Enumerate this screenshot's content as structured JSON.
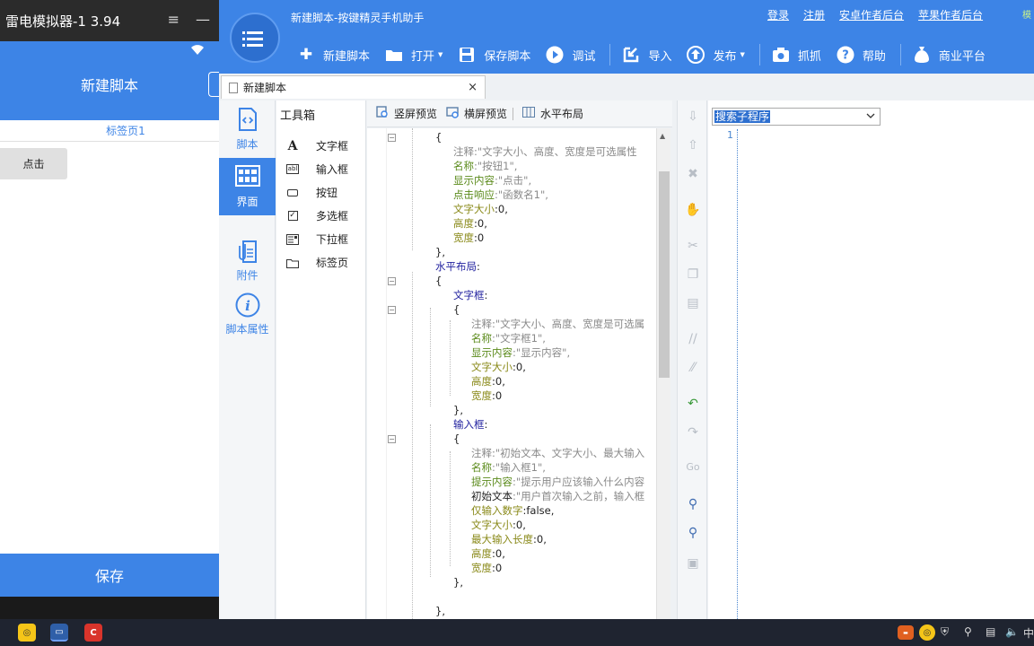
{
  "emulator": {
    "title": "雷电模拟器-1 3.94",
    "menu_icon": "≡",
    "minimize_icon": "—",
    "wifi_icon": "wifi-icon",
    "header_title": "新建脚本",
    "tab_label": "标签页1",
    "button_label": "点击",
    "save_label": "保存"
  },
  "app": {
    "title": "新建脚本-按键精灵手机助手",
    "links": [
      "登录",
      "注册",
      "安卓作者后台",
      "苹果作者后台"
    ],
    "link_more": "模",
    "toolbar": [
      {
        "label": "新建脚本",
        "icon": "plus-icon",
        "caret": false
      },
      {
        "label": "打开",
        "icon": "folder-icon",
        "caret": true
      },
      {
        "label": "保存脚本",
        "icon": "floppy-icon",
        "caret": false
      },
      {
        "label": "调试",
        "icon": "play-icon",
        "caret": false
      },
      {
        "label": "导入",
        "icon": "import-icon",
        "caret": false
      },
      {
        "label": "发布",
        "icon": "publish-icon",
        "caret": true
      },
      {
        "label": "抓抓",
        "icon": "camera-icon",
        "caret": false
      },
      {
        "label": "帮助",
        "icon": "help-icon",
        "caret": false
      },
      {
        "label": "商业平台",
        "icon": "money-bag-icon",
        "caret": false
      }
    ],
    "doc_tab": "新建脚本",
    "doc_tab_close": "×",
    "nav": [
      {
        "label": "脚本",
        "icon": "script-icon",
        "active": false
      },
      {
        "label": "界面",
        "icon": "layout-icon",
        "active": true
      },
      {
        "label": "附件",
        "icon": "attachment-icon",
        "active": false
      },
      {
        "label": "脚本属性",
        "icon": "info-icon",
        "active": false
      }
    ],
    "toolbox": {
      "title": "工具箱",
      "items": [
        {
          "label": "文字框",
          "icon": "text-icon"
        },
        {
          "label": "输入框",
          "icon": "input-icon"
        },
        {
          "label": "按钮",
          "icon": "button-icon"
        },
        {
          "label": "多选框",
          "icon": "checkbox-icon"
        },
        {
          "label": "下拉框",
          "icon": "dropdown-icon"
        },
        {
          "label": "标签页",
          "icon": "tabpage-icon"
        }
      ]
    },
    "editor_tools": [
      "竖屏预览",
      "横屏预览",
      "水平布局"
    ],
    "code_lines": [
      {
        "indent": 2,
        "parts": [
          [
            "",
            "{"
          ]
        ]
      },
      {
        "indent": 3,
        "parts": [
          [
            "c-cm",
            "注释:\"文字大小、高度、宽度是可选属性"
          ]
        ]
      },
      {
        "indent": 3,
        "parts": [
          [
            "c-gr",
            "名称"
          ],
          [
            "c-cm",
            ":\"按钮1\","
          ]
        ]
      },
      {
        "indent": 3,
        "parts": [
          [
            "c-gr",
            "显示内容"
          ],
          [
            "c-cm",
            ":\"点击\","
          ]
        ]
      },
      {
        "indent": 3,
        "parts": [
          [
            "c-gr",
            "点击响应"
          ],
          [
            "c-cm",
            ":\"函数名1\","
          ]
        ]
      },
      {
        "indent": 3,
        "parts": [
          [
            "c-ol",
            "文字大小"
          ],
          [
            "",
            ":0,"
          ]
        ]
      },
      {
        "indent": 3,
        "parts": [
          [
            "c-ol",
            "高度"
          ],
          [
            "",
            ":0,"
          ]
        ]
      },
      {
        "indent": 3,
        "parts": [
          [
            "c-ol",
            "宽度"
          ],
          [
            "",
            ":0"
          ]
        ]
      },
      {
        "indent": 2,
        "parts": [
          [
            "",
            "},"
          ]
        ]
      },
      {
        "indent": 2,
        "parts": [
          [
            "c-bl",
            "水平布局"
          ],
          [
            "",
            ":"
          ]
        ]
      },
      {
        "indent": 2,
        "parts": [
          [
            "",
            "{"
          ]
        ]
      },
      {
        "indent": 3,
        "parts": [
          [
            "c-bl",
            "文字框"
          ],
          [
            "",
            ":"
          ]
        ]
      },
      {
        "indent": 3,
        "parts": [
          [
            "",
            "{"
          ]
        ]
      },
      {
        "indent": 4,
        "parts": [
          [
            "c-cm",
            "注释:\"文字大小、高度、宽度是可选属"
          ]
        ]
      },
      {
        "indent": 4,
        "parts": [
          [
            "c-gr",
            "名称"
          ],
          [
            "c-cm",
            ":\"文字框1\","
          ]
        ]
      },
      {
        "indent": 4,
        "parts": [
          [
            "c-gr",
            "显示内容"
          ],
          [
            "c-cm",
            ":\"显示内容\","
          ]
        ]
      },
      {
        "indent": 4,
        "parts": [
          [
            "c-ol",
            "文字大小"
          ],
          [
            "",
            ":0,"
          ]
        ]
      },
      {
        "indent": 4,
        "parts": [
          [
            "c-ol",
            "高度"
          ],
          [
            "",
            ":0,"
          ]
        ]
      },
      {
        "indent": 4,
        "parts": [
          [
            "c-ol",
            "宽度"
          ],
          [
            "",
            ":0"
          ]
        ]
      },
      {
        "indent": 3,
        "parts": [
          [
            "",
            "},"
          ]
        ]
      },
      {
        "indent": 3,
        "parts": [
          [
            "c-bl",
            "输入框"
          ],
          [
            "",
            ":"
          ]
        ]
      },
      {
        "indent": 3,
        "parts": [
          [
            "",
            "{"
          ]
        ]
      },
      {
        "indent": 4,
        "parts": [
          [
            "c-cm",
            "注释:\"初始文本、文字大小、最大输入"
          ]
        ]
      },
      {
        "indent": 4,
        "parts": [
          [
            "c-gr",
            "名称"
          ],
          [
            "c-cm",
            ":\"输入框1\","
          ]
        ]
      },
      {
        "indent": 4,
        "parts": [
          [
            "c-gr",
            "提示内容"
          ],
          [
            "c-cm",
            ":\"提示用户应该输入什么内容"
          ]
        ]
      },
      {
        "indent": 4,
        "parts": [
          [
            "",
            "初始文本"
          ],
          [
            "c-cm",
            ":\"用户首次输入之前，输入框"
          ]
        ]
      },
      {
        "indent": 4,
        "parts": [
          [
            "c-ol",
            "仅输入数字"
          ],
          [
            "",
            ":false,"
          ]
        ]
      },
      {
        "indent": 4,
        "parts": [
          [
            "c-ol",
            "文字大小"
          ],
          [
            "",
            ":0,"
          ]
        ]
      },
      {
        "indent": 4,
        "parts": [
          [
            "c-ol",
            "最大输入长度"
          ],
          [
            "",
            ":0,"
          ]
        ]
      },
      {
        "indent": 4,
        "parts": [
          [
            "c-ol",
            "高度"
          ],
          [
            "",
            ":0,"
          ]
        ]
      },
      {
        "indent": 4,
        "parts": [
          [
            "c-ol",
            "宽度"
          ],
          [
            "",
            ":0"
          ]
        ]
      },
      {
        "indent": 3,
        "parts": [
          [
            "",
            "},"
          ]
        ]
      },
      {
        "indent": 3,
        "parts": [
          [
            "",
            ""
          ]
        ]
      },
      {
        "indent": 2,
        "parts": [
          [
            "",
            "},"
          ]
        ]
      }
    ],
    "sub_select": "搜索子程序",
    "sub_line_number": "1"
  },
  "taskbar": {
    "tray_text": "中"
  },
  "colors": {
    "brand_blue": "#3d84e6",
    "emulator_title": "#2b2b2b"
  }
}
